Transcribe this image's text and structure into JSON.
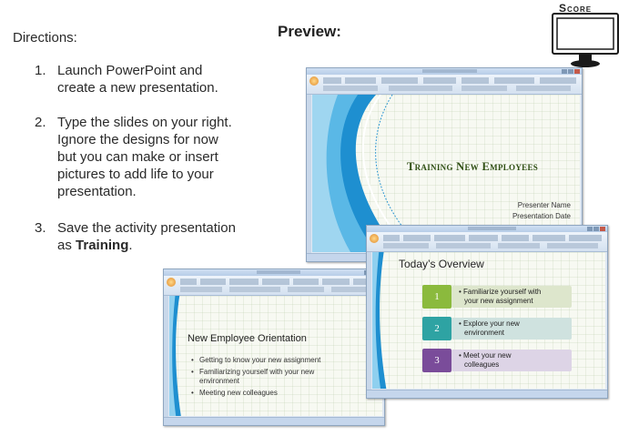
{
  "directions": {
    "heading": "Directions:",
    "steps": [
      {
        "number": "1.",
        "line1": "Launch PowerPoint and",
        "line2": "create a new presentation."
      },
      {
        "number": "2.",
        "line1": "Type the slides on your right.",
        "line2": "Ignore the designs for now",
        "line3": "but you can make or insert",
        "line4": "pictures to add life to your",
        "line5": "presentation."
      },
      {
        "number": "3.",
        "line1": "Save the activity presentation",
        "line2_prefix": "as ",
        "line2_bold": "Training",
        "line2_suffix": "."
      }
    ]
  },
  "preview": {
    "heading": "Preview:"
  },
  "score": {
    "label": "Score",
    "icon": "monitor-icon"
  },
  "slides": {
    "title_slide": {
      "title": "Training New Employees",
      "presenter": "Presenter Name",
      "date": "Presentation Date"
    },
    "orientation_slide": {
      "title": "New Employee Orientation",
      "bullets": [
        {
          "line1": "Getting to know your new assignment"
        },
        {
          "line1": "Familiarizing yourself with your new",
          "line2": "environment"
        },
        {
          "line1": "Meeting new colleagues"
        }
      ]
    },
    "overview_slide": {
      "title": "Today’s Overview",
      "items": [
        {
          "number": "1",
          "line1": "• Familiarize yourself with",
          "line2": "your new assignment"
        },
        {
          "number": "2",
          "line1": "• Explore your new",
          "line2": "environment"
        },
        {
          "number": "3",
          "line1": "• Meet your new",
          "line2": "colleagues"
        }
      ]
    }
  },
  "colors": {
    "title_slide_text": "#2f4f14",
    "overview_green": "#8bba3d",
    "overview_teal": "#2ea3a3",
    "overview_purple": "#7a4c9a",
    "theme_wave_blue": "#1e8fd0"
  }
}
